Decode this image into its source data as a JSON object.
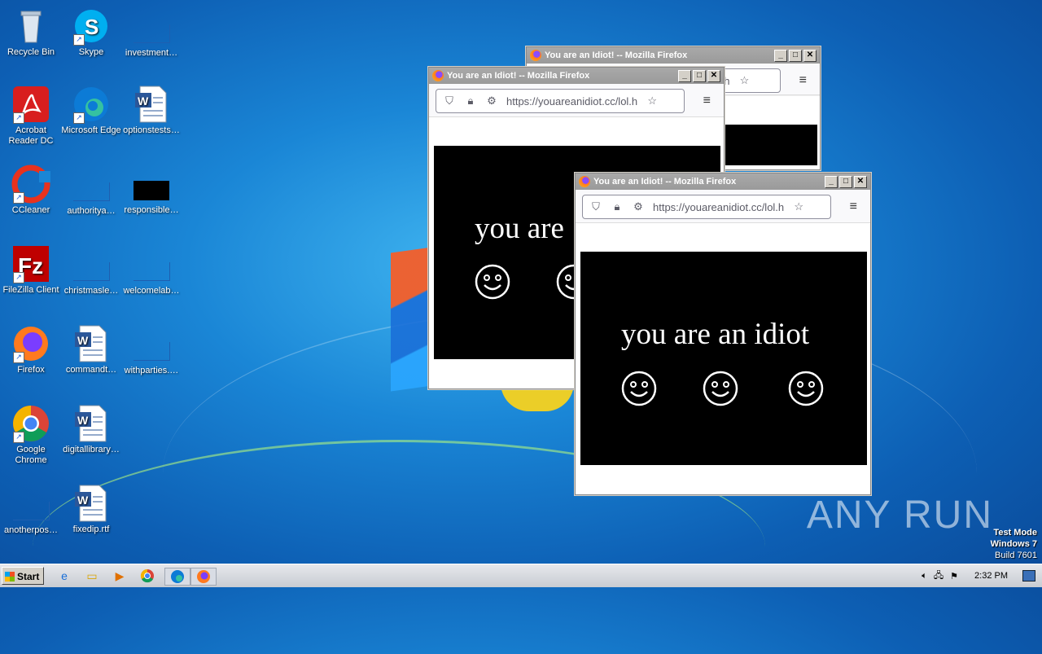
{
  "desktop_icons": [
    {
      "label": "Recycle Bin",
      "icon": "recycle-bin-icon"
    },
    {
      "label": "Skype",
      "icon": "skype-icon"
    },
    {
      "label": "investment…",
      "icon": "blank-file-icon"
    },
    {
      "label": "Acrobat Reader DC",
      "icon": "acrobat-icon"
    },
    {
      "label": "Microsoft Edge",
      "icon": "edge-icon"
    },
    {
      "label": "optionstests…",
      "icon": "word-doc-icon"
    },
    {
      "label": "CCleaner",
      "icon": "ccleaner-icon"
    },
    {
      "label": "authoritya…",
      "icon": "blank-file-icon"
    },
    {
      "label": "responsible…",
      "icon": "black-file-icon"
    },
    {
      "label": "FileZilla Client",
      "icon": "filezilla-icon"
    },
    {
      "label": "christmasle…",
      "icon": "blank-file-icon"
    },
    {
      "label": "welcomelab…",
      "icon": "blank-file-icon"
    },
    {
      "label": "Firefox",
      "icon": "firefox-icon"
    },
    {
      "label": "commandt…",
      "icon": "word-doc-icon"
    },
    {
      "label": "withparties.…",
      "icon": "blank-file-icon"
    },
    {
      "label": "Google Chrome",
      "icon": "chrome-icon"
    },
    {
      "label": "digitallibrary…",
      "icon": "word-doc-icon"
    },
    {
      "label": "anotherpos…",
      "icon": "blank-file-icon"
    },
    {
      "label": "fixedip.rtf",
      "icon": "word-doc-icon"
    }
  ],
  "windows": [
    {
      "title": "You are an Idiot! -- Mozilla Firefox",
      "url": "cc/lol.h"
    },
    {
      "title": "You are an Idiot! -- Mozilla Firefox",
      "url": "https://youareanidiot.cc/lol.h",
      "text": "you are"
    },
    {
      "title": "You are an Idiot! -- Mozilla Firefox",
      "url": "https://youareanidiot.cc/lol.h",
      "text": "you are an idiot"
    }
  ],
  "taskbar": {
    "start_label": "Start",
    "clock": "2:32 PM"
  },
  "watermark": "ANY RUN",
  "test_mode": {
    "line1": "Test Mode",
    "line2": "Windows 7",
    "line3": "Build 7601"
  },
  "colors": {
    "desktop_blue": "#1a86d6",
    "title_inactive": "#a0a0a0",
    "page_black": "#000000"
  }
}
